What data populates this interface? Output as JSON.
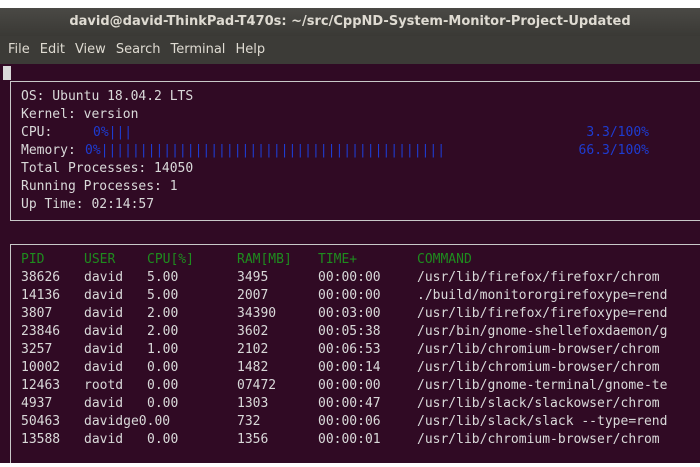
{
  "window": {
    "title": "david@david-ThinkPad-T470s: ~/src/CppND-System-Monitor-Project-Updated",
    "menu": [
      "File",
      "Edit",
      "View",
      "Search",
      "Terminal",
      "Help"
    ]
  },
  "system": {
    "os_label": "OS: Ubuntu 18.04.2 LTS",
    "kernel_label": "Kernel: version",
    "cpu_label": "CPU:",
    "cpu_bar": "0%|||",
    "cpu_percent": "3.3/100%",
    "memory_label": "Memory:",
    "memory_bar": "0%||||||||||||||||||||||||||||||||||||||||||||",
    "memory_percent": "66.3/100%",
    "total_processes": "Total Processes: 14050",
    "running_processes": "Running Processes: 1",
    "up_time": "Up Time: 02:14:57",
    "colors": {
      "bar": "#1e3cd2",
      "header": "#1e8c1e",
      "background": "#300a24"
    }
  },
  "processes": {
    "headers": [
      "PID",
      "USER",
      "CPU[%]",
      "RAM[MB]",
      "TIME+",
      "COMMAND"
    ],
    "rows": [
      [
        "38626",
        "david",
        "5.00",
        "3495",
        "00:00:00",
        "/usr/lib/firefox/firefoxr/chrom"
      ],
      [
        "14136",
        "david",
        "5.00",
        "2007",
        "00:00:00",
        "./build/monitororgirefoxype=rend"
      ],
      [
        "3807",
        "david",
        "2.00",
        "34390",
        "00:03:00",
        "/usr/lib/firefox/firefoxype=rend"
      ],
      [
        "23846",
        "david",
        "2.00",
        "3602",
        "00:05:38",
        "/usr/bin/gnome-shellefoxdaemon/g"
      ],
      [
        "3257",
        "david",
        "1.00",
        "2102",
        "00:06:53",
        "/usr/lib/chromium-browser/chrom"
      ],
      [
        "10002",
        "david",
        "0.00",
        "1482",
        "00:00:14",
        "/usr/lib/chromium-browser/chrom"
      ],
      [
        "12463",
        "rootd",
        "0.00",
        "07472",
        "00:00:00",
        "/usr/lib/gnome-terminal/gnome-te"
      ],
      [
        "4937",
        "david",
        "0.00",
        "1303",
        "00:00:47",
        "/usr/lib/slack/slackowser/chrom"
      ],
      [
        "50463",
        "davidge0.00",
        "",
        "732",
        "00:00:06",
        "/usr/lib/slack/slack --type=rend"
      ],
      [
        "13588",
        "david",
        "0.00",
        "1356",
        "00:00:01",
        "/usr/lib/chromium-browser/chrom"
      ]
    ]
  }
}
